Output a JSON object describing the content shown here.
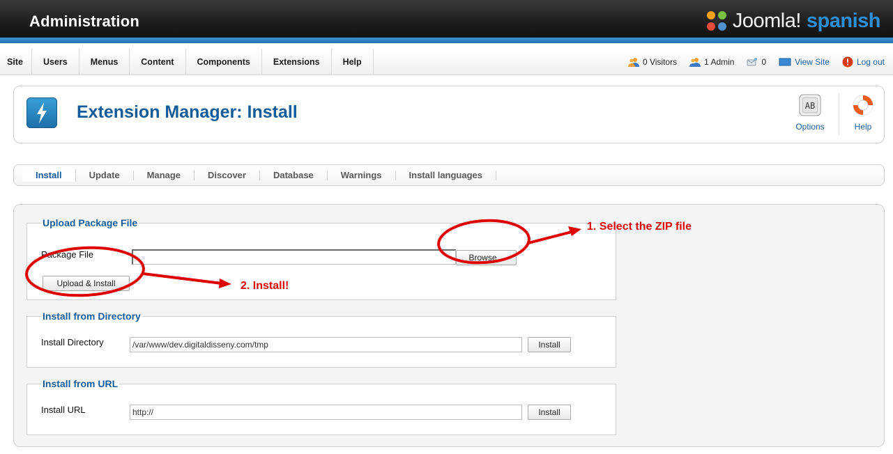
{
  "header": {
    "title": "Administration",
    "brand": {
      "name": "Joomla!",
      "suffix": "spanish"
    },
    "accent_color": "#2a8fd6"
  },
  "menu": {
    "items": [
      {
        "label": "Site"
      },
      {
        "label": "Users"
      },
      {
        "label": "Menus"
      },
      {
        "label": "Content"
      },
      {
        "label": "Components"
      },
      {
        "label": "Extensions"
      },
      {
        "label": "Help"
      }
    ]
  },
  "status": {
    "visitors": "0 Visitors",
    "admins": "1 Admin",
    "messages": "0",
    "view_site": "View Site",
    "logout": "Log out"
  },
  "toolbar": {
    "page_title": "Extension Manager: Install",
    "page_icon": "lightning-icon",
    "options_label": "Options",
    "help_label": "Help"
  },
  "subnav": {
    "tabs": [
      {
        "label": "Install",
        "active": true
      },
      {
        "label": "Update"
      },
      {
        "label": "Manage"
      },
      {
        "label": "Discover"
      },
      {
        "label": "Database"
      },
      {
        "label": "Warnings"
      },
      {
        "label": "Install languages"
      }
    ]
  },
  "upload": {
    "legend": "Upload Package File",
    "label": "Package File",
    "value": "",
    "browse_label": "Browse...",
    "submit_label": "Upload & Install"
  },
  "directory": {
    "legend": "Install from Directory",
    "label": "Install Directory",
    "value": "/var/www/dev.digitaldisseny.com/tmp",
    "button": "Install"
  },
  "url": {
    "legend": "Install from URL",
    "label": "Install URL",
    "value": "http://",
    "button": "Install"
  },
  "annotations": {
    "step1": "1. Select the ZIP file",
    "step2": "2. Install!",
    "color": "#e00000"
  }
}
